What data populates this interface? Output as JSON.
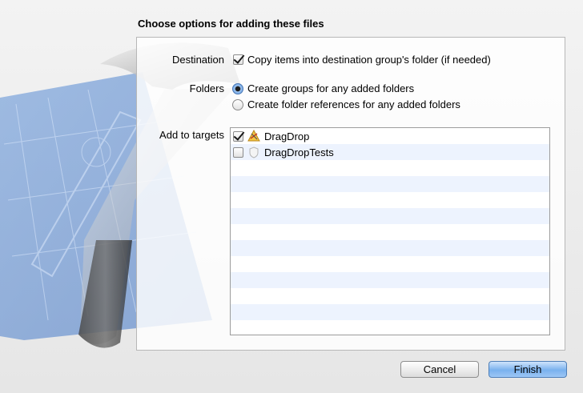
{
  "dialog": {
    "title": "Choose options for adding these files"
  },
  "destination": {
    "label": "Destination",
    "option_label": "Copy items into destination group's folder (if needed)",
    "checked": true
  },
  "folders": {
    "label": "Folders",
    "options": [
      {
        "label": "Create groups for any added folders",
        "selected": true
      },
      {
        "label": "Create folder references for any added folders",
        "selected": false
      }
    ]
  },
  "targets": {
    "label": "Add to targets",
    "items": [
      {
        "label": "DragDrop",
        "checked": true,
        "icon": "app-target-icon"
      },
      {
        "label": "DragDropTests",
        "checked": false,
        "icon": "test-bundle-icon"
      }
    ]
  },
  "buttons": {
    "cancel": "Cancel",
    "finish": "Finish"
  },
  "colors": {
    "selection_blue": "#79b1ee",
    "row_stripe": "#edf3fe"
  }
}
